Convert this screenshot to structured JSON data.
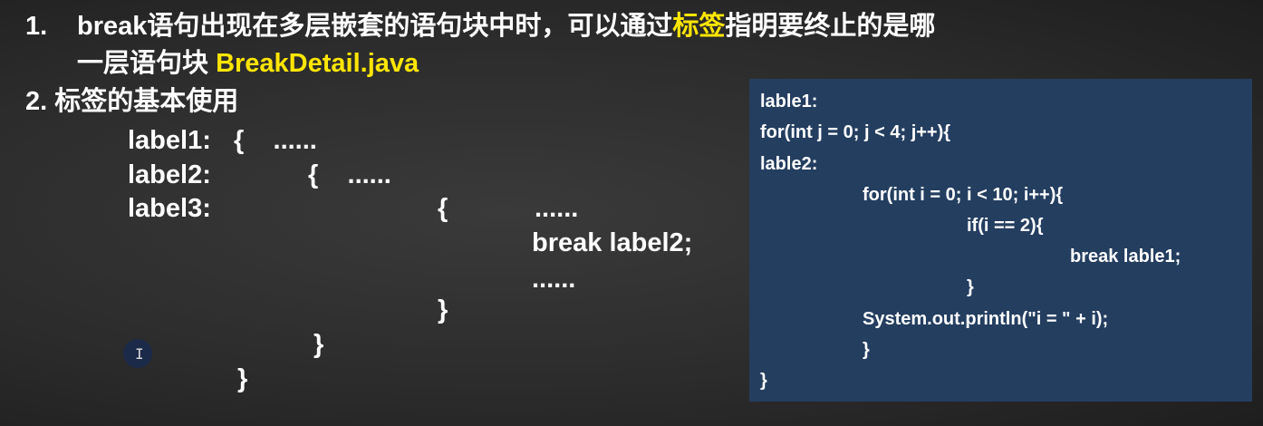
{
  "item1": {
    "num": "1.",
    "line1_a": "break语句出现在多层嵌套的语句块中时，可以通过",
    "line1_highlight": "标签",
    "line1_b": "指明要终止的是哪",
    "line2_a": "一层语句块 ",
    "line2_file": "BreakDetail.java"
  },
  "item2": {
    "title": "2. 标签的基本使用"
  },
  "diagram": {
    "label1": "label1:",
    "label1_open": "{    ......",
    "label2": "label2:",
    "label2_open": "{    ......",
    "label3": "label3:",
    "label3_open": "{",
    "dots1": "......",
    "break": "break label2;",
    "dots2": "......",
    "close3": "}",
    "close2": "}",
    "close1": "}"
  },
  "code": [
    "lable1:",
    "for(int j = 0; j < 4; j++){",
    "lable2:",
    "for(int i = 0; i < 10; i++){",
    "if(i == 2){",
    "break lable1;",
    "}",
    "System.out.println(\"i = \" + i);",
    "}",
    "}"
  ],
  "cursor": {
    "icon": "text-cursor-icon",
    "glyph": "I"
  },
  "colors": {
    "highlight": "#ffe600",
    "code_bg": "#243e60"
  }
}
